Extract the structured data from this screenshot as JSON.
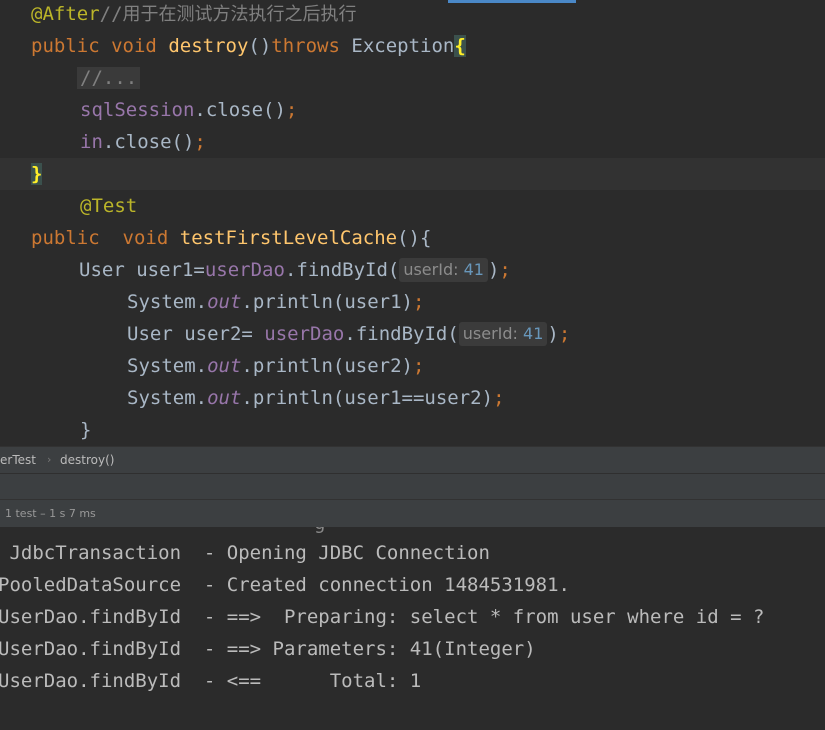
{
  "editor": {
    "lines": [
      {
        "annotation": "@After",
        "comment": "//",
        "comment_cjk": "用于在测试方法执行之后执行"
      },
      {
        "kw1": "public",
        "kw2": "void",
        "method": "destroy",
        "paren": "()",
        "throws": "throws",
        "exception": "Exception",
        "brace": "{"
      },
      {
        "folded": "//..."
      },
      {
        "field": "sqlSession",
        "call": ".close()",
        "semi": ";"
      },
      {
        "field": "in",
        "call": ".close()",
        "semi": ";"
      },
      {
        "brace": "}"
      },
      {
        "annotation": "@Test"
      },
      {
        "kw1": "public",
        "kw2": "void",
        "method": "testFirstLevelCache",
        "rest": "(){"
      },
      {
        "type": "User",
        "var": "user1=",
        "field": "userDao",
        "call": ".findById(",
        "hint_name": "userId:",
        "hint_val": "41",
        "close": ")",
        "semi": ";"
      },
      {
        "cls": "System.",
        "static_field": "out",
        "call": ".println(user1)",
        "semi": ";"
      },
      {
        "type": "User",
        "var": "user2= ",
        "field": "userDao",
        "call": ".findById(",
        "hint_name": "userId:",
        "hint_val": "41",
        "close": ")",
        "semi": ";"
      },
      {
        "cls": "System.",
        "static_field": "out",
        "call": ".println(user2)",
        "semi": ";"
      },
      {
        "cls": "System.",
        "static_field": "out",
        "call": ".println(user1==user2)",
        "semi": ";"
      },
      {
        "brace": "}"
      }
    ]
  },
  "breadcrumb": {
    "class_name": "erTest",
    "separator": "›",
    "method": "destroy()"
  },
  "run_status": {
    "text": "1 test – 1 s 7 ms"
  },
  "console": {
    "partial_top": "g",
    "lines": [
      {
        "logger": " JdbcTransaction ",
        "message": " - Opening JDBC Connection"
      },
      {
        "logger": "PooledDataSource ",
        "message": " - Created connection 1484531981."
      },
      {
        "logger": "UserDao.findById ",
        "message": " - ==>  Preparing: select * from user where id = ?"
      },
      {
        "logger": "UserDao.findById ",
        "message": " - ==> Parameters: 41(Integer)"
      },
      {
        "logger": "UserDao.findById ",
        "message": " - <==      Total: 1"
      }
    ]
  },
  "colors": {
    "background": "#2b2b2b",
    "keyword": "#cc7832",
    "method": "#ffc66d",
    "annotation": "#bbb529",
    "field": "#9876aa",
    "number": "#6897bb",
    "comment": "#808080",
    "text": "#a9b7c6"
  }
}
